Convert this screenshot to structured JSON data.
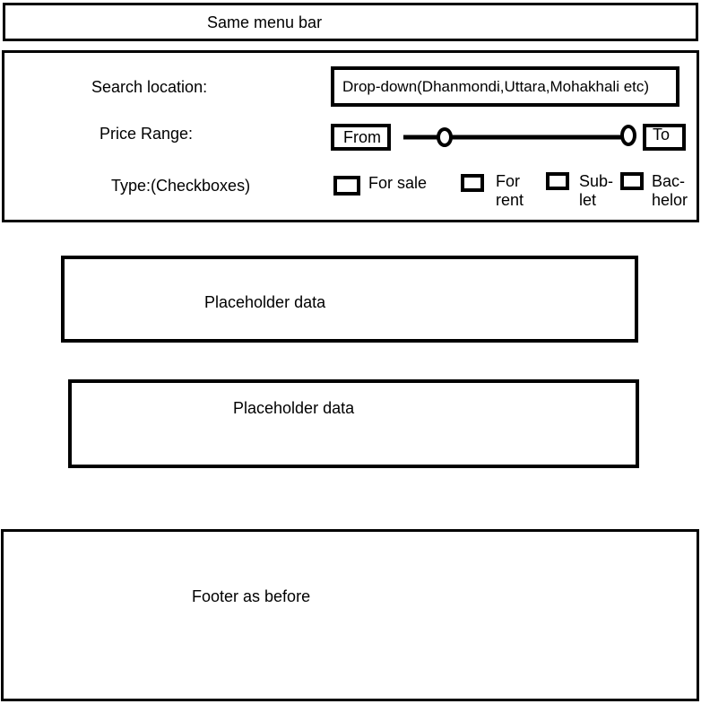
{
  "menu_bar": {
    "label": "Same menu bar"
  },
  "search_panel": {
    "location_label": "Search location:",
    "location_dropdown_value": "Drop-down(Dhanmondi,Uttara,Mohakhali etc)",
    "price_label": "Price Range:",
    "price_from_label": "From",
    "price_to_label": "To",
    "type_label": "Type:(Checkboxes)",
    "types": [
      {
        "label": "For sale",
        "checked": false
      },
      {
        "label": "For rent",
        "checked": false
      },
      {
        "label": "Sub-let",
        "checked": false
      },
      {
        "label": "Bac-helor",
        "checked": false
      }
    ]
  },
  "results": [
    {
      "text": "Placeholder data"
    },
    {
      "text": "Placeholder data"
    }
  ],
  "footer": {
    "label": "Footer as before"
  }
}
